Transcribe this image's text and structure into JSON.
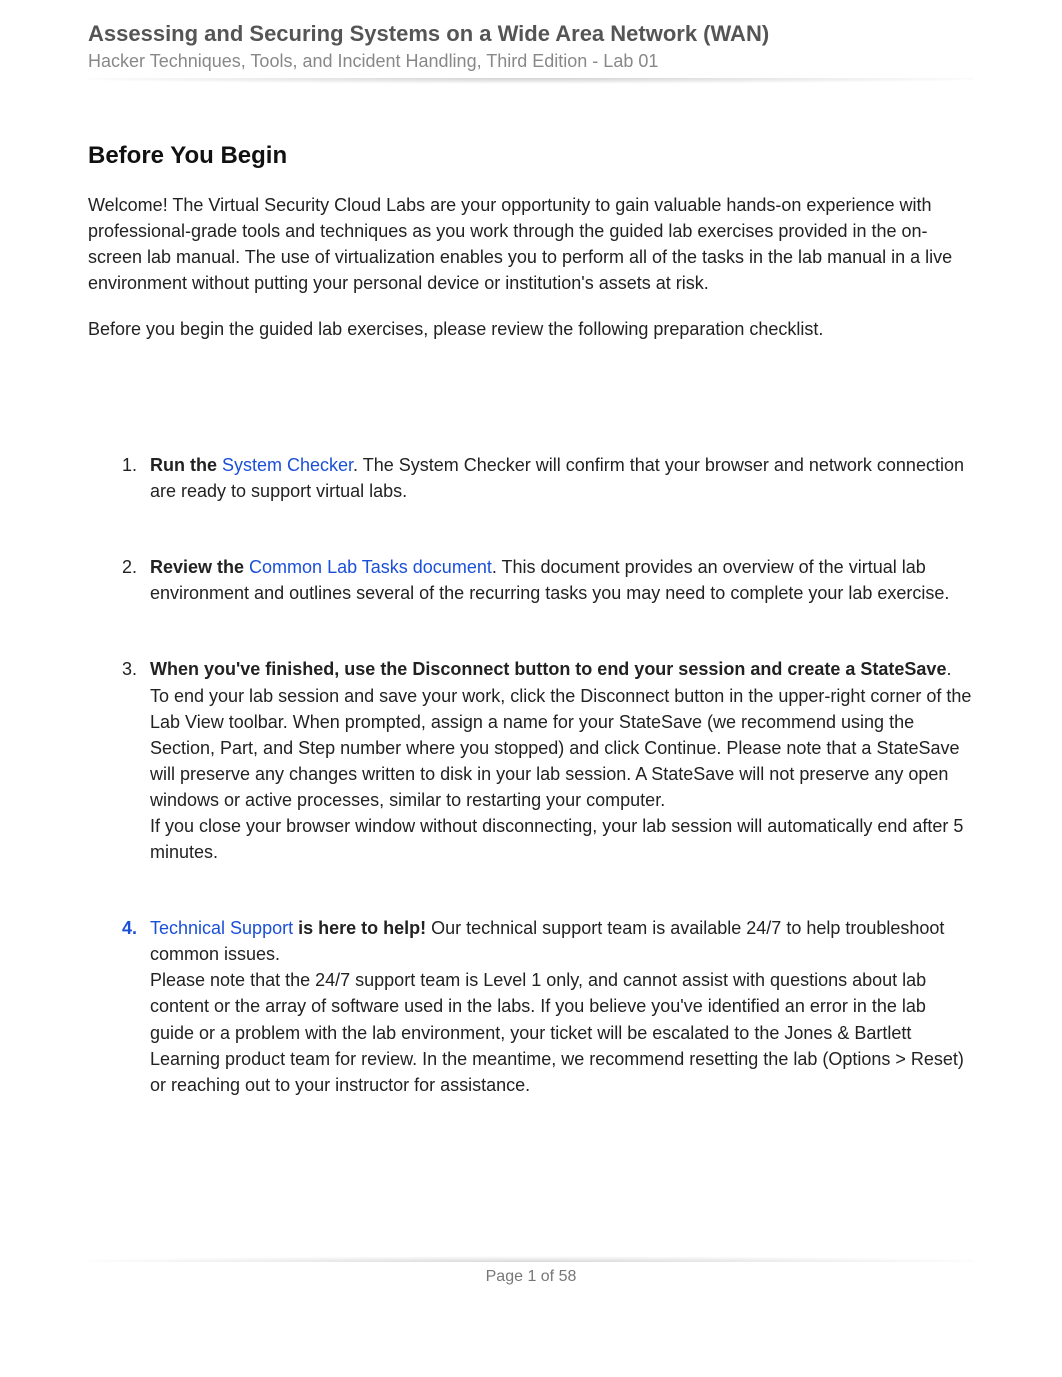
{
  "header": {
    "title": "Assessing and Securing Systems on a Wide Area Network (WAN)",
    "subtitle": "Hacker Techniques, Tools, and Incident Handling, Third Edition - Lab 01"
  },
  "section_heading": "Before You Begin",
  "intro_p1": "Welcome! The Virtual Security Cloud Labs are your opportunity to gain valuable hands-on experience with professional-grade tools and techniques as you work through the guided lab exercises provided in the on-screen lab manual. The use of virtualization enables you to perform all of the tasks in the lab manual in a live environment without putting your personal device or institution's assets at risk.",
  "intro_p2": "Before you begin the guided lab exercises, please review the following preparation checklist.",
  "items": [
    {
      "marker": "1.",
      "lead_bold": "Run the ",
      "link": "System Checker",
      "tail": ". The System Checker will confirm that your browser and network connection are ready to support virtual labs.",
      "p2": ""
    },
    {
      "marker": "2.",
      "lead_bold": "Review the ",
      "link": "Common Lab Tasks document",
      "tail": ". This document provides an overview of the virtual lab environment and outlines several of the recurring tasks you may need to complete your lab exercise.",
      "p2": ""
    },
    {
      "marker": "3.",
      "lead_bold": "When you've finished, use the Disconnect button to end your session and create a StateSave",
      "link": "",
      "tail": ". To end your lab session and save your work, click the Disconnect button in the upper-right corner of the Lab View toolbar. When prompted, assign a name for your StateSave (we recommend using the Section, Part, and Step number where you stopped) and click Continue. Please note that a StateSave will preserve any changes written to disk in your lab session. A StateSave will not preserve any open windows or active processes, similar to restarting your computer.",
      "p2": "If you close your browser window without disconnecting, your lab session will automatically end after 5 minutes."
    },
    {
      "marker": "4.",
      "lead_bold": "",
      "link": "Technical Support",
      "mid_bold": " is here to help!",
      "tail": " Our technical support team is available 24/7 to help troubleshoot common issues.",
      "p2": "Please note that the 24/7 support team is Level 1 only, and cannot assist with questions about lab content or the array of software used in the labs. If you believe you've identified an error in the lab guide or a problem with the lab environment, your ticket will be escalated to the Jones & Bartlett Learning product team for review. In the meantime, we recommend resetting the lab (Options > Reset) or reaching out to your instructor for assistance."
    }
  ],
  "footer": "Page 1 of 58"
}
